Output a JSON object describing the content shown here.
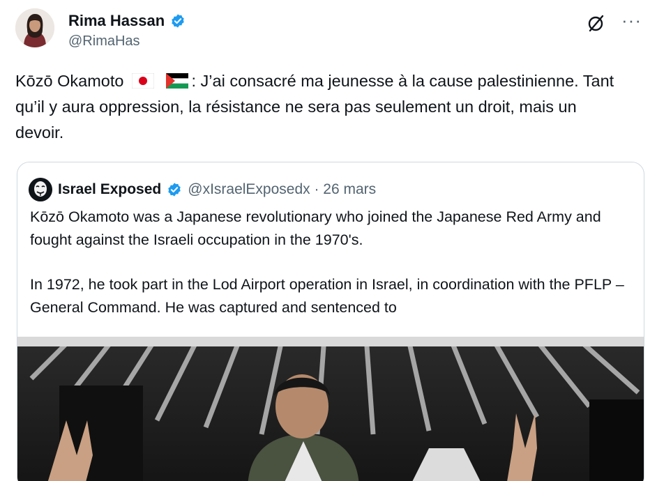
{
  "author": {
    "display_name": "Rima Hassan",
    "handle": "@RimaHas"
  },
  "tweet": {
    "text_prefix": "Kōzō Okamoto",
    "text_suffix": ": J’ai consacré ma jeunesse à la cause palestinienne. Tant qu’il y aura oppression, la résistance ne sera pas seulement un droit, mais un devoir."
  },
  "quote": {
    "display_name": "Israel Exposed",
    "meta": "@xIsraelExposedx · 26 mars",
    "paragraph_1": "Kōzō Okamoto was a Japanese revolutionary who joined the Japanese Red Army and fought against the Israeli occupation in the 1970's.",
    "paragraph_2": "In 1972, he took part in the Lod Airport operation in Israel, in coordination with the PFLP – General Command. He was captured and sentenced to"
  },
  "icons": [
    "avatar",
    "verified-badge-icon",
    "grok-icon",
    "more-icon",
    "japan-flag-icon",
    "palestine-flag-icon"
  ],
  "colors": {
    "verified": "#1d9bf0",
    "secondary_text": "#536471",
    "border": "#cfd9de"
  }
}
